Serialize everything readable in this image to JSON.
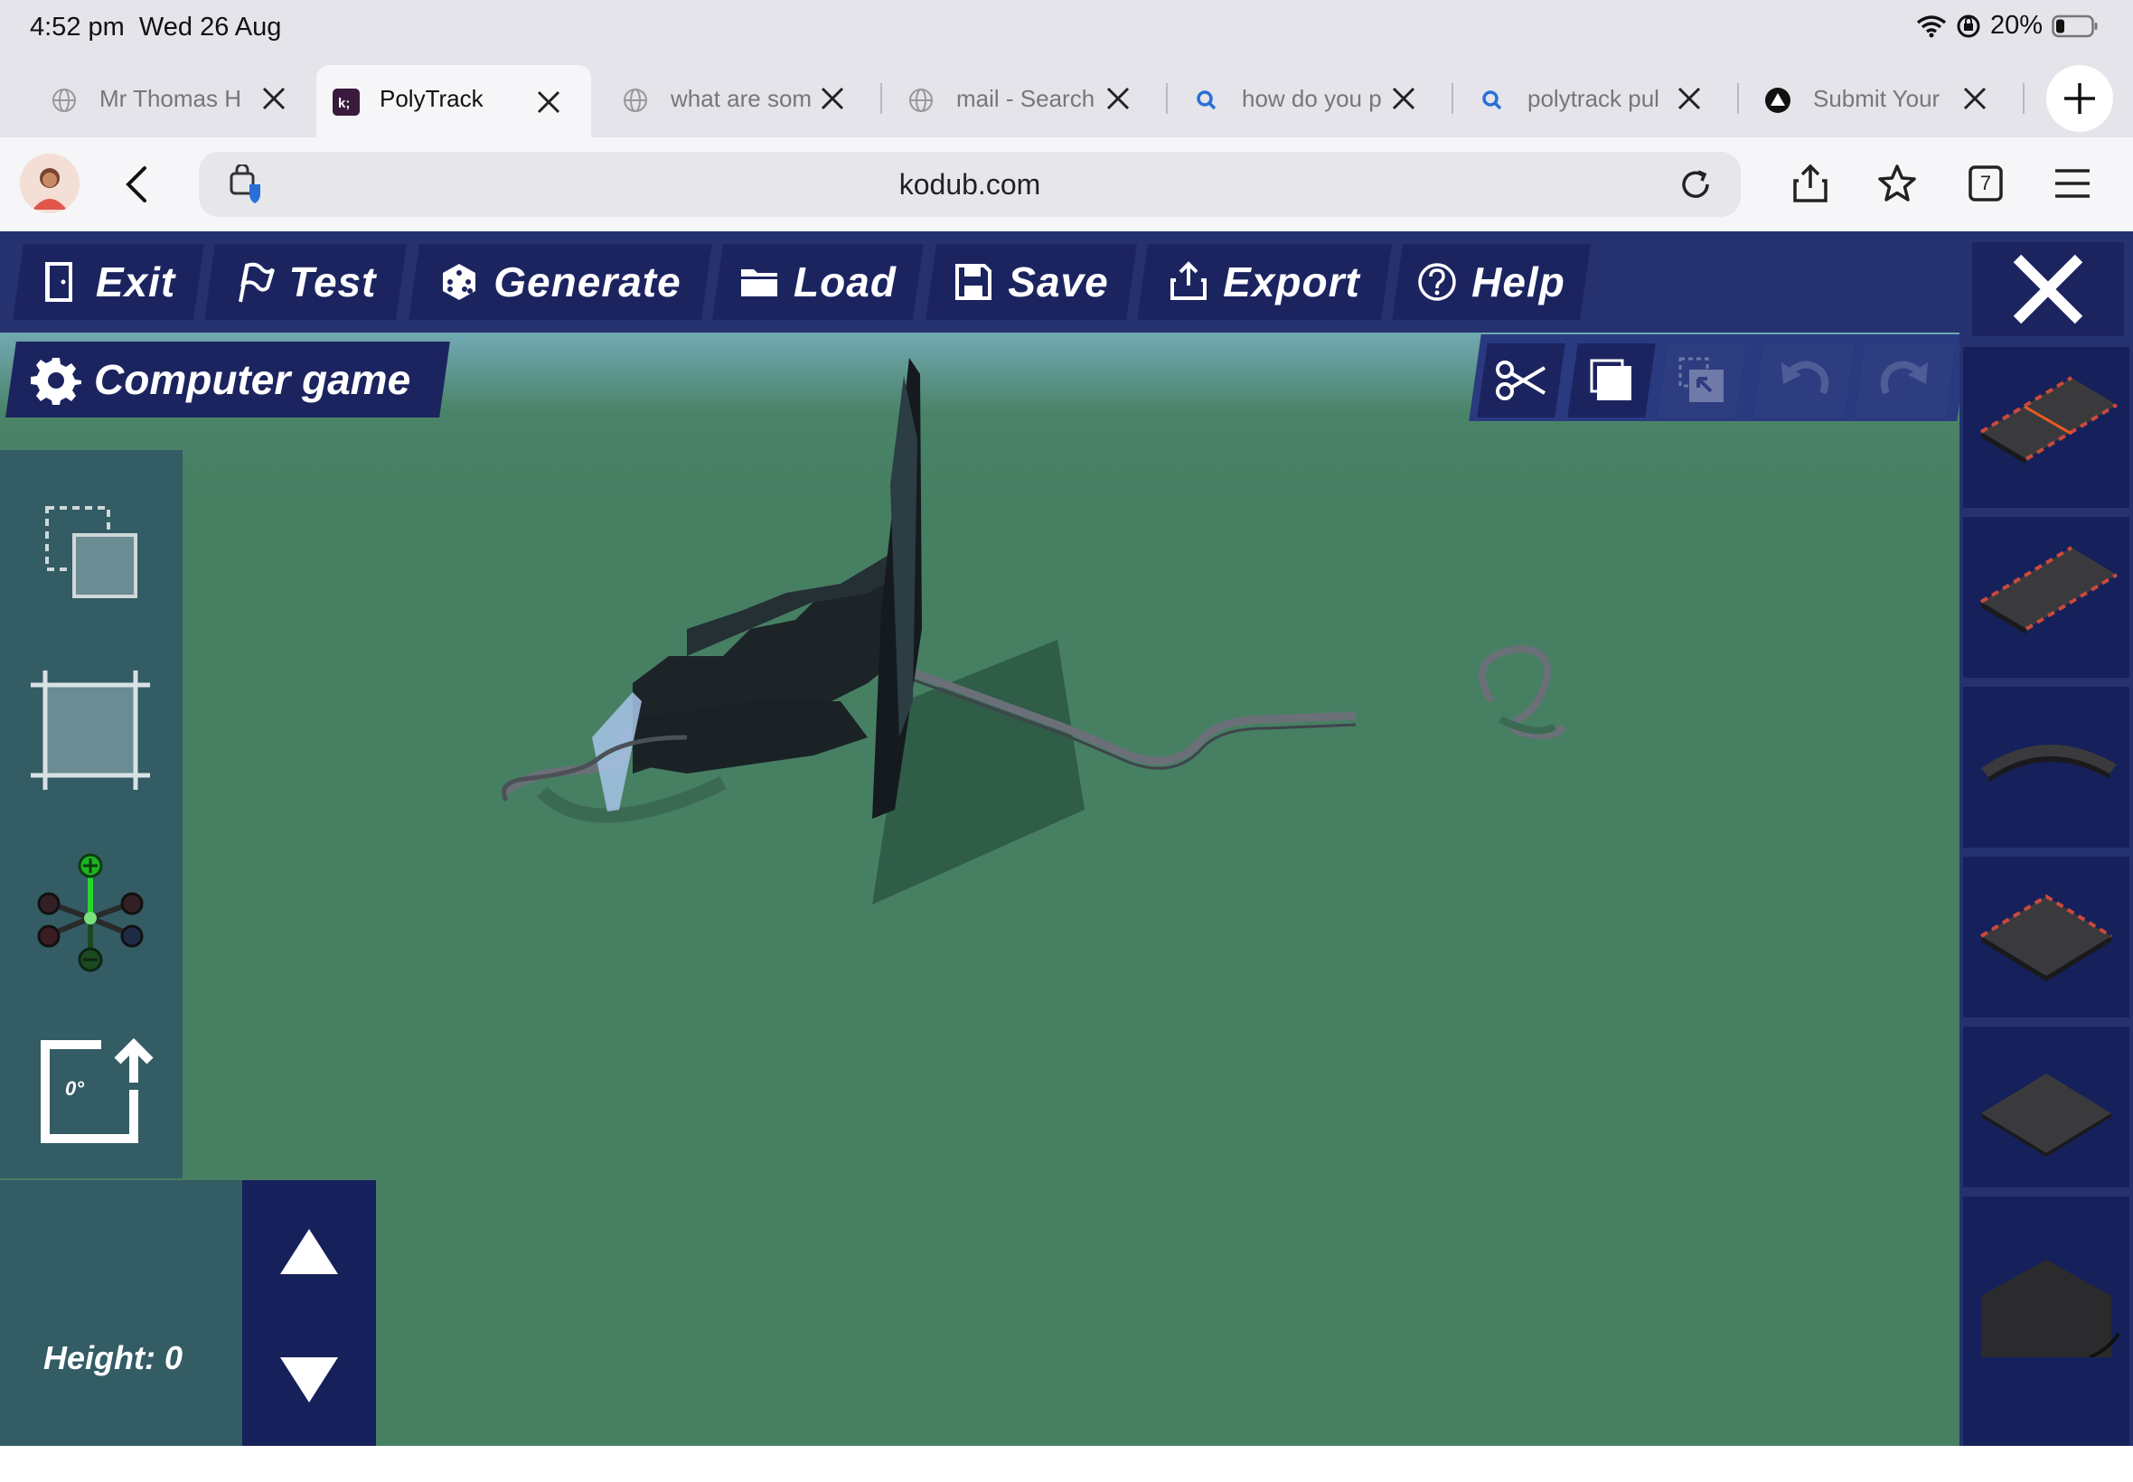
{
  "status": {
    "time": "4:52 pm",
    "date": "Wed 26 Aug",
    "battery": "20%"
  },
  "tabs": [
    {
      "title": "Mr Thomas H",
      "icon": "globe-icon",
      "active": false
    },
    {
      "title": "PolyTrack",
      "icon": "kodub-icon",
      "active": true
    },
    {
      "title": "what are som",
      "icon": "globe-icon",
      "active": false
    },
    {
      "title": "mail - Search",
      "icon": "globe-icon",
      "active": false
    },
    {
      "title": "how do you p",
      "icon": "search-icon",
      "active": false
    },
    {
      "title": "polytrack pul",
      "icon": "search-icon",
      "active": false
    },
    {
      "title": "Submit Your",
      "icon": "triangle-logo-icon",
      "active": false
    }
  ],
  "address": {
    "url": "kodub.com",
    "tab_count": "7"
  },
  "game": {
    "menu": {
      "exit": "Exit",
      "test": "Test",
      "generate": "Generate",
      "load": "Load",
      "save": "Save",
      "export": "Export",
      "help": "Help"
    },
    "track_name": "Computer game",
    "height_label": "Height: 0",
    "rotation_label": "0°",
    "colors": {
      "menu_bar": "#263270",
      "button": "#1c2460",
      "ground": "#477f63",
      "tool_panel": "#335c64"
    }
  }
}
